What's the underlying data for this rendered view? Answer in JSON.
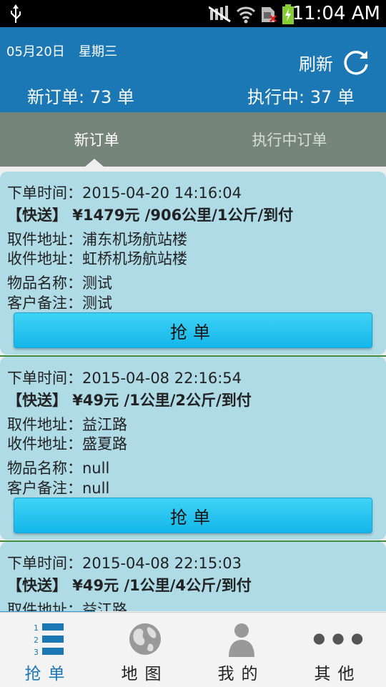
{
  "status_bar": {
    "time": "11:04 AM"
  },
  "header": {
    "date": "05月20日",
    "weekday": "星期三",
    "refresh_label": "刷新",
    "new_orders": "新订单: 73 单",
    "executing_orders": "执行中: 37 单"
  },
  "tabs": {
    "new": "新订单",
    "executing": "执行中订单"
  },
  "orders": [
    {
      "time": "下单时间：2015-04-20 14:16:04",
      "summary": "【快送】 ¥1479元 /906公里/1公斤/到付",
      "pickup": "取件地址：浦东机场航站楼",
      "delivery": "收件地址：虹桥机场航站楼",
      "item": "物品名称：测试",
      "note": "客户备注：测试",
      "button": "抢单"
    },
    {
      "time": "下单时间：2015-04-08 22:16:54",
      "summary": "【快送】 ¥49元 /1公里/2公斤/到付",
      "pickup": "取件地址：益江路",
      "delivery": "收件地址：盛夏路",
      "item": "物品名称：null",
      "note": "客户备注：null",
      "button": "抢单"
    },
    {
      "time": "下单时间：2015-04-08 22:15:03",
      "summary": "【快送】 ¥49元 /1公里/4公斤/到付",
      "pickup": "取件地址：益江路"
    }
  ],
  "bottom_nav": [
    {
      "label": "抢单",
      "icon": "list-icon",
      "active": true
    },
    {
      "label": "地图",
      "icon": "globe-icon",
      "active": false
    },
    {
      "label": "我的",
      "icon": "person-icon",
      "active": false
    },
    {
      "label": "其他",
      "icon": "more-icon",
      "active": false
    }
  ],
  "colors": {
    "header": "#1c78b4",
    "tabs": "#75857a",
    "card": "#aedbe6",
    "button": "#2cc6f0",
    "active_nav": "#1c78b4"
  }
}
